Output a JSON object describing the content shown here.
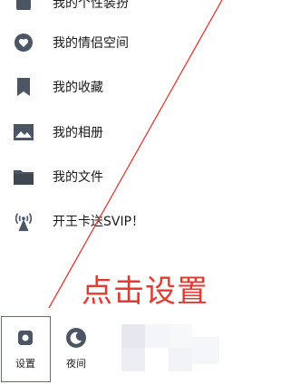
{
  "menu": {
    "items": [
      {
        "label": "我的个性装扮",
        "icon": "outfit-icon"
      },
      {
        "label": "我的情侣空间",
        "icon": "heart-icon"
      },
      {
        "label": "我的收藏",
        "icon": "bookmark-icon"
      },
      {
        "label": "我的相册",
        "icon": "photo-icon"
      },
      {
        "label": "我的文件",
        "icon": "folder-icon"
      },
      {
        "label": "开王卡送SVIP！",
        "icon": "signal-tower-icon"
      }
    ]
  },
  "annotation": {
    "text": "点击设置",
    "color": "#e43a32"
  },
  "bottom_bar": {
    "settings_label": "设置",
    "night_label": "夜间"
  },
  "colors": {
    "icon_gray": "#4b5563",
    "accent_red": "#e43a32"
  }
}
